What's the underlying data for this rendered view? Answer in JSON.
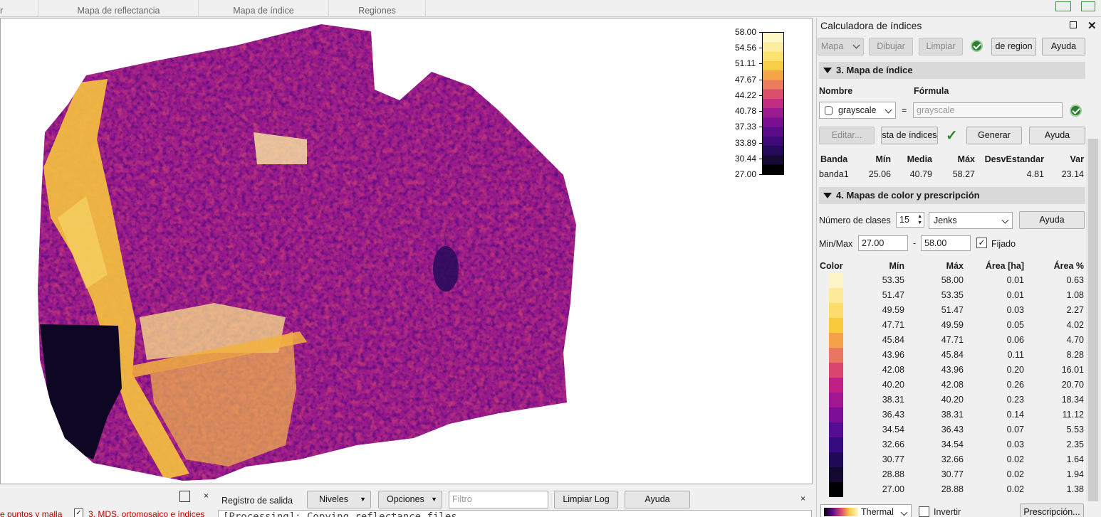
{
  "top_tabs": {
    "t0": "r",
    "t1": "Mapa de reflectancia",
    "t2": "Mapa de índice",
    "t3": "Regiones"
  },
  "colorbar": {
    "labels": [
      "58.00",
      "54.56",
      "51.11",
      "47.67",
      "44.22",
      "40.78",
      "37.33",
      "33.89",
      "30.44",
      "27.00"
    ],
    "colors": [
      "#fdf7c5",
      "#fceea1",
      "#fbe36f",
      "#f9cd46",
      "#f5a447",
      "#ec7c5b",
      "#d94f6d",
      "#c02d83",
      "#9b1a8f",
      "#7a0f92",
      "#5b0c8a",
      "#3f0a77",
      "#250a5a",
      "#150936",
      "#000004"
    ]
  },
  "panel": {
    "title": "Calculadora de índices",
    "toolbar": {
      "mapa": "Mapa",
      "dibujar": "Dibujar",
      "limpiar": "Limpiar",
      "region": "de region",
      "ayuda": "Ayuda"
    },
    "section3": "3. Mapa de índice",
    "nombre_label": "Nombre",
    "formula_label": "Fórmula",
    "nombre_value": "grayscale",
    "equals": "=",
    "formula_value": "grayscale",
    "buttons": {
      "editar": "Editar...",
      "lista": "sta de índices",
      "generar": "Generar",
      "ayuda": "Ayuda"
    },
    "stats_headers": {
      "banda": "Banda",
      "min": "Mín",
      "media": "Media",
      "max": "Máx",
      "desv": "DesvEstandar",
      "var": "Var"
    },
    "stats_row": {
      "banda": "banda1",
      "min": "25.06",
      "media": "40.79",
      "max": "58.27",
      "desv": "4.81",
      "var": "23.14"
    },
    "section4": "4. Mapas de color y prescripción",
    "num_clases_label": "Número de clases",
    "num_clases": "15",
    "method": "Jenks",
    "ayuda2": "Ayuda",
    "minmax_label": "Min/Max",
    "min_value": "27.00",
    "dash": "-",
    "max_value": "58.00",
    "fijado": "Fijado",
    "class_headers": {
      "color": "Color",
      "min": "Mín",
      "max": "Máx",
      "area_ha": "Área [ha]",
      "area_pct": "Área %"
    },
    "classes": [
      {
        "color": "#fdf5c8",
        "min": "53.35",
        "max": "58.00",
        "ha": "0.01",
        "pct": "0.63"
      },
      {
        "color": "#fde99a",
        "min": "51.47",
        "max": "53.35",
        "ha": "0.01",
        "pct": "1.08"
      },
      {
        "color": "#fcdc6a",
        "min": "49.59",
        "max": "51.47",
        "ha": "0.03",
        "pct": "2.27"
      },
      {
        "color": "#f9cb3c",
        "min": "47.71",
        "max": "49.59",
        "ha": "0.05",
        "pct": "4.02"
      },
      {
        "color": "#f4a24a",
        "min": "45.84",
        "max": "47.71",
        "ha": "0.06",
        "pct": "4.70"
      },
      {
        "color": "#e9765f",
        "min": "43.96",
        "max": "45.84",
        "ha": "0.11",
        "pct": "8.28"
      },
      {
        "color": "#d9466f",
        "min": "42.08",
        "max": "43.96",
        "ha": "0.20",
        "pct": "16.01"
      },
      {
        "color": "#c11f85",
        "min": "40.20",
        "max": "42.08",
        "ha": "0.26",
        "pct": "20.70"
      },
      {
        "color": "#a0178f",
        "min": "38.31",
        "max": "40.20",
        "ha": "0.23",
        "pct": "18.34"
      },
      {
        "color": "#7b1097",
        "min": "36.43",
        "max": "38.31",
        "ha": "0.14",
        "pct": "11.12"
      },
      {
        "color": "#550d96",
        "min": "34.54",
        "max": "36.43",
        "ha": "0.07",
        "pct": "5.53"
      },
      {
        "color": "#360b80",
        "min": "32.66",
        "max": "34.54",
        "ha": "0.03",
        "pct": "2.35"
      },
      {
        "color": "#200a55",
        "min": "30.77",
        "max": "32.66",
        "ha": "0.02",
        "pct": "1.64"
      },
      {
        "color": "#130830",
        "min": "28.88",
        "max": "30.77",
        "ha": "0.02",
        "pct": "1.94"
      },
      {
        "color": "#000004",
        "min": "27.00",
        "max": "28.88",
        "ha": "0.02",
        "pct": "1.38"
      }
    ],
    "palette": "Thermal",
    "invertir": "Invertir",
    "prescripcion": "Prescripción..."
  },
  "bottom": {
    "left1": "e puntos y malla",
    "left2": "3. MDS, ortomosaico e índices",
    "registro": "Registro de salida",
    "niveles": "Niveles",
    "opciones": "Opciones",
    "filtro_placeholder": "Filtro",
    "limpiar_log": "Limpiar Log",
    "ayuda": "Ayuda",
    "log_line": "[Processing]: Copying reflectance files"
  }
}
